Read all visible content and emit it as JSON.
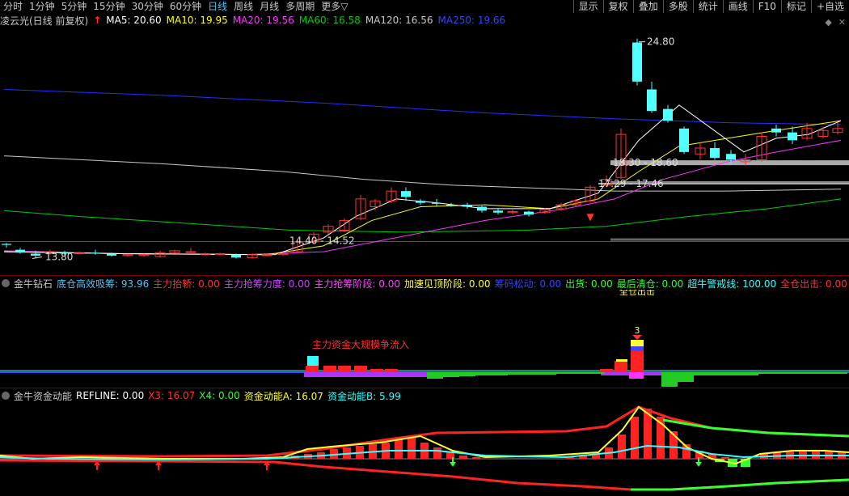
{
  "toolbar": {
    "periods": [
      "分时",
      "1分钟",
      "5分钟",
      "15分钟",
      "30分钟",
      "60分钟",
      "日线",
      "周线",
      "月线",
      "多周期",
      "更多▽"
    ],
    "active_period": "日线",
    "right_buttons": [
      "显示",
      "复权",
      "叠加",
      "多股",
      "统计",
      "画线",
      "F10",
      "标记",
      "+自选"
    ]
  },
  "main": {
    "stock_title": "凌云光(日线 前复权)",
    "ma_labels": {
      "ma5": "MA5: 20.60",
      "ma10": "MA10: 19.95",
      "ma20": "MA20: 19.56",
      "ma60": "MA60: 16.58",
      "ma120": "MA120: 16.56",
      "ma250": "MA250: 19.66"
    },
    "price_labels": {
      "high": "24.80",
      "low": "13.80",
      "box1": "14.40 - 14.52",
      "box2": "17.29 - 17.46",
      "box3": "18.30 - 18.60"
    }
  },
  "indicator1": {
    "name": "金牛钻石",
    "fields": [
      {
        "text": "底仓高效吸筹: 93.96",
        "color": "#4fc3f7"
      },
      {
        "text": "主力抬轿: 0.00",
        "color": "#ff3333"
      },
      {
        "text": "主力抢筹力度: 0.00",
        "color": "#cc44ff"
      },
      {
        "text": "主力抢筹阶段: 0.00",
        "color": "#ff44ff"
      },
      {
        "text": "加速见顶阶段: 0.00",
        "color": "#ffff33"
      },
      {
        "text": "筹码松动: 0.00",
        "color": "#3344ff"
      },
      {
        "text": "出货: 0.00",
        "color": "#33ff33"
      },
      {
        "text": "最后清仓: 0.00",
        "color": "#33ff33"
      },
      {
        "text": "超牛警戒线: 100.00",
        "color": "#33ffff"
      },
      {
        "text": "全仓出击: 0.00",
        "color": "#ff3333"
      },
      {
        "text": ": 0.00",
        "color": "#ffffff"
      }
    ],
    "annotation": "主力资金大规模争流入",
    "annotation2": "全仓出击",
    "marker": "3"
  },
  "indicator2": {
    "name": "金牛资金动能",
    "fields": [
      {
        "text": "REFLINE: 0.00",
        "color": "#ffffff"
      },
      {
        "text": "X3: 16.07",
        "color": "#ff3333"
      },
      {
        "text": "X4: 0.00",
        "color": "#33ff33"
      },
      {
        "text": "资金动能A: 16.07",
        "color": "#ffff33"
      },
      {
        "text": "资金动能B: 5.99",
        "color": "#33ffff"
      }
    ]
  },
  "colors": {
    "up": "#ff3333",
    "down": "#54ffff",
    "ma5": "#ffffff",
    "ma10": "#ffff00",
    "ma20": "#ff33ff",
    "ma60": "#00cc00",
    "ma120": "#c8c8c8",
    "ma250": "#2233ff"
  }
}
